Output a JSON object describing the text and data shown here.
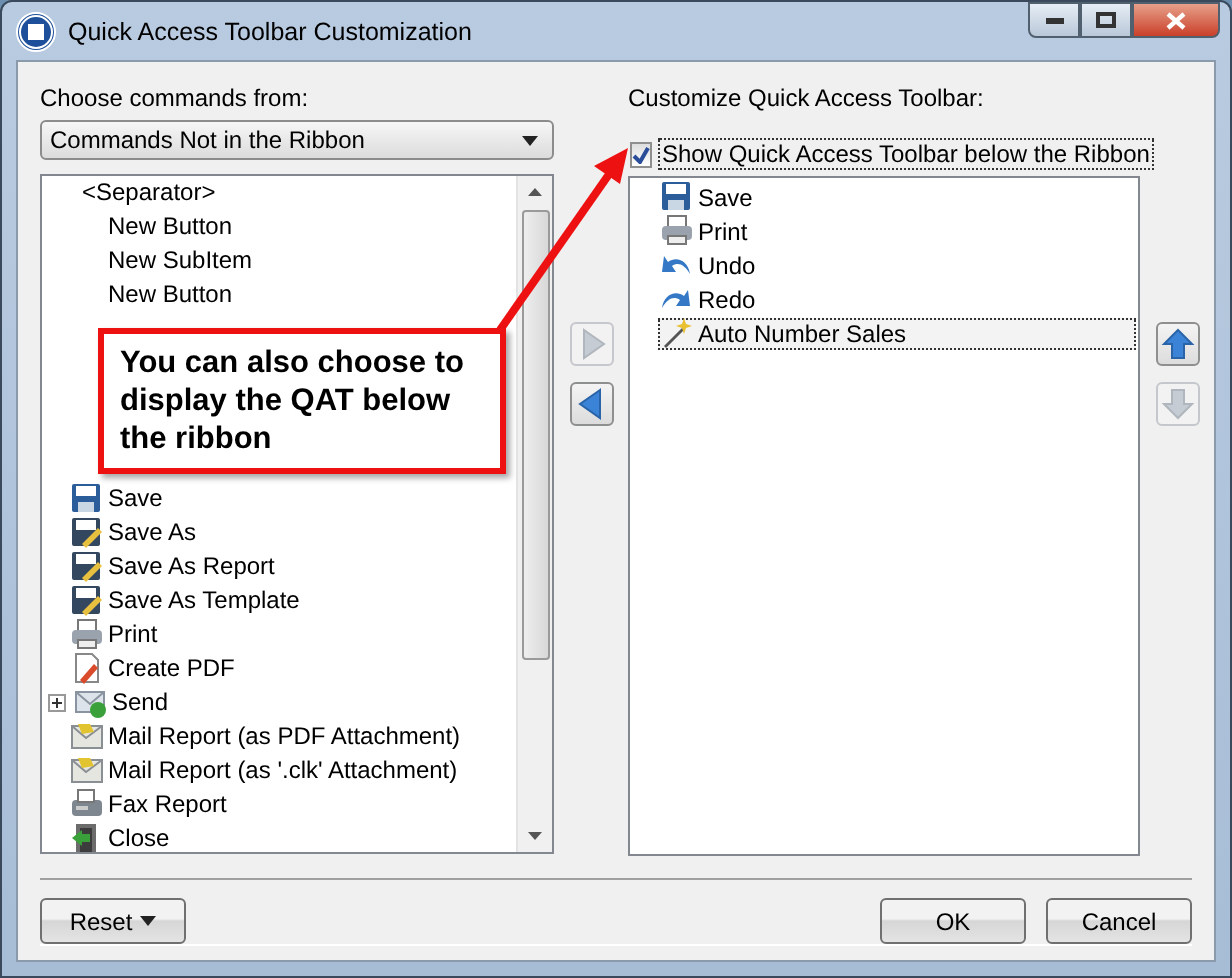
{
  "window": {
    "title": "Quick Access Toolbar Customization"
  },
  "left": {
    "label": "Choose commands from:",
    "dropdown": {
      "value": "Commands Not in the Ribbon"
    },
    "items": [
      {
        "label": "<Separator>",
        "kind": "separator"
      },
      {
        "label": "New Button",
        "kind": "plain"
      },
      {
        "label": "New SubItem",
        "kind": "plain"
      },
      {
        "label": "New Button",
        "kind": "plain"
      },
      {
        "kind": "hidden"
      },
      {
        "kind": "hidden"
      },
      {
        "kind": "hidden"
      },
      {
        "kind": "hidden"
      },
      {
        "kind": "hidden"
      },
      {
        "label": "Save",
        "kind": "save"
      },
      {
        "label": "Save As",
        "kind": "save-as"
      },
      {
        "label": "Save As Report",
        "kind": "save-as"
      },
      {
        "label": "Save As Template",
        "kind": "save-as"
      },
      {
        "label": "Print",
        "kind": "print"
      },
      {
        "label": "Create PDF",
        "kind": "pdf"
      },
      {
        "label": "Send",
        "kind": "send",
        "expanded": false
      },
      {
        "label": "Mail Report (as PDF Attachment)",
        "kind": "mail"
      },
      {
        "label": "Mail Report (as '.clk' Attachment)",
        "kind": "mail"
      },
      {
        "label": "Fax Report",
        "kind": "fax"
      },
      {
        "label": "Close",
        "kind": "close"
      }
    ]
  },
  "move_buttons": [
    {
      "kind": "add",
      "disabled": true
    },
    {
      "kind": "remove",
      "disabled": false
    }
  ],
  "right": {
    "label": "Customize Quick Access Toolbar:",
    "checkbox": {
      "label": "Show Quick Access Toolbar below the Ribbon",
      "checked": true
    },
    "items": [
      {
        "label": "Save",
        "kind": "save",
        "selected": false
      },
      {
        "label": "Print",
        "kind": "print",
        "selected": false
      },
      {
        "label": "Undo",
        "kind": "undo",
        "selected": false
      },
      {
        "label": "Redo",
        "kind": "redo",
        "selected": false
      },
      {
        "label": "Auto Number Sales",
        "kind": "wand",
        "selected": true
      }
    ]
  },
  "order_buttons": [
    {
      "kind": "up",
      "disabled": false
    },
    {
      "kind": "down",
      "disabled": true
    }
  ],
  "callout": {
    "text": "You can also choose to display the QAT below the ribbon"
  },
  "buttons": [
    {
      "label": "Reset",
      "kind": "menu"
    },
    {
      "label": "OK",
      "kind": "plain"
    },
    {
      "label": "Cancel",
      "kind": "plain"
    }
  ]
}
